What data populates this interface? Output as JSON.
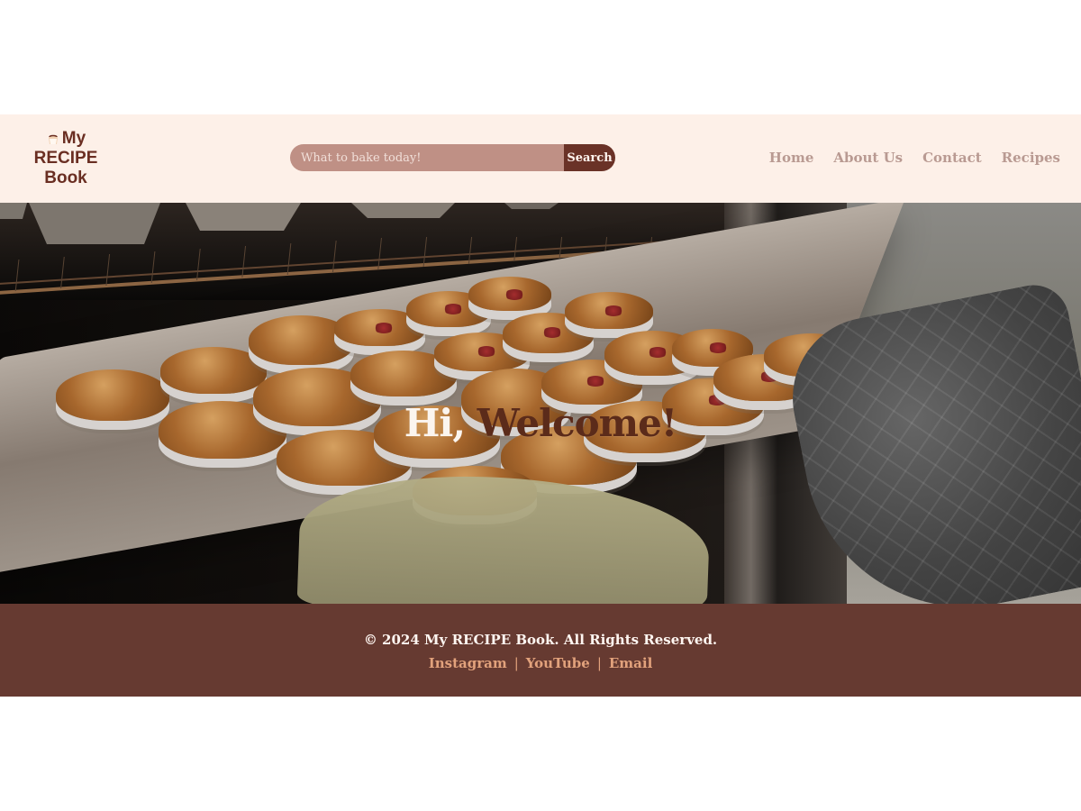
{
  "header": {
    "logo": {
      "line1": "My",
      "line2": "RECIPE",
      "line3": "Book",
      "icon": "muffin-logo-icon"
    },
    "search": {
      "placeholder": "What to bake today!",
      "button_label": "Search"
    },
    "nav": [
      {
        "label": "Home"
      },
      {
        "label": "About Us"
      },
      {
        "label": "Contact"
      },
      {
        "label": "Recipes"
      }
    ]
  },
  "hero": {
    "greeting": "Hi,",
    "welcome": " Welcome!"
  },
  "footer": {
    "copyright": "© 2024 My RECIPE Book. All Rights Reserved.",
    "links": [
      {
        "label": "Instagram"
      },
      {
        "label": "YouTube"
      },
      {
        "label": "Email"
      }
    ],
    "separator": "|"
  },
  "colors": {
    "header_background": "#fdf0e8",
    "logo_brown": "#6a2e22",
    "search_background": "#bf9085",
    "search_button": "#6a3227",
    "nav_text": "#b99a92",
    "footer_background": "#663a31",
    "footer_link": "#e2a27c",
    "hero_welcome": "#5b2b1a"
  }
}
